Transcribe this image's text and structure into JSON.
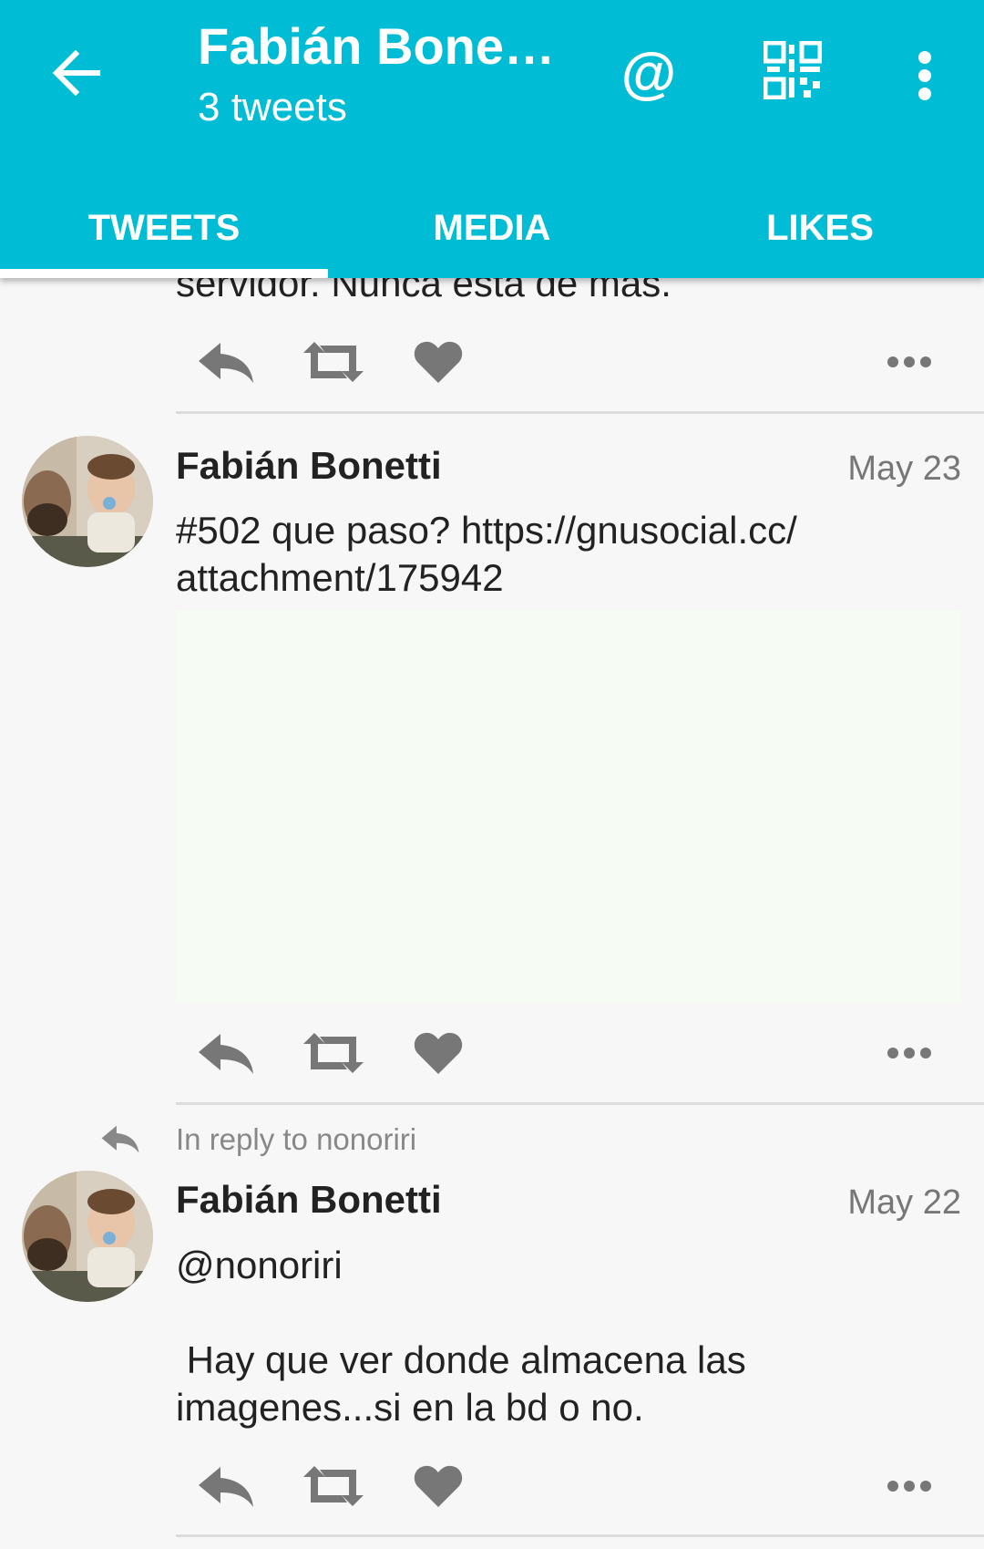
{
  "app_bar": {
    "title": "Fabián Bone…",
    "subtitle": "3 tweets",
    "mention_label": "@",
    "icons": [
      "arrow-left-icon",
      "at-icon",
      "qr-code-icon",
      "more-vert-icon"
    ],
    "background_color": "#00bcd4"
  },
  "tabs": [
    {
      "label": "TWEETS",
      "active": true
    },
    {
      "label": "MEDIA",
      "active": false
    },
    {
      "label": "LIKES",
      "active": false
    }
  ],
  "timeline": {
    "partial_tweet": {
      "text": "servidor. Nunca esta de mas."
    },
    "tweets": [
      {
        "author": "Fabián Bonetti",
        "date": "May 23",
        "text": "#502 que paso? https://gnusocial.cc/\nattachment/175942",
        "has_attachment": true
      },
      {
        "reply_note": "In reply to nonoriri",
        "author": "Fabián Bonetti",
        "date": "May 22",
        "text": "@nonoriri\n\n Hay que ver donde almacena las\nimagenes...si en la bd o no."
      }
    ],
    "action_icons": [
      "reply-icon",
      "retweet-icon",
      "heart-icon",
      "more-horiz-icon"
    ]
  }
}
